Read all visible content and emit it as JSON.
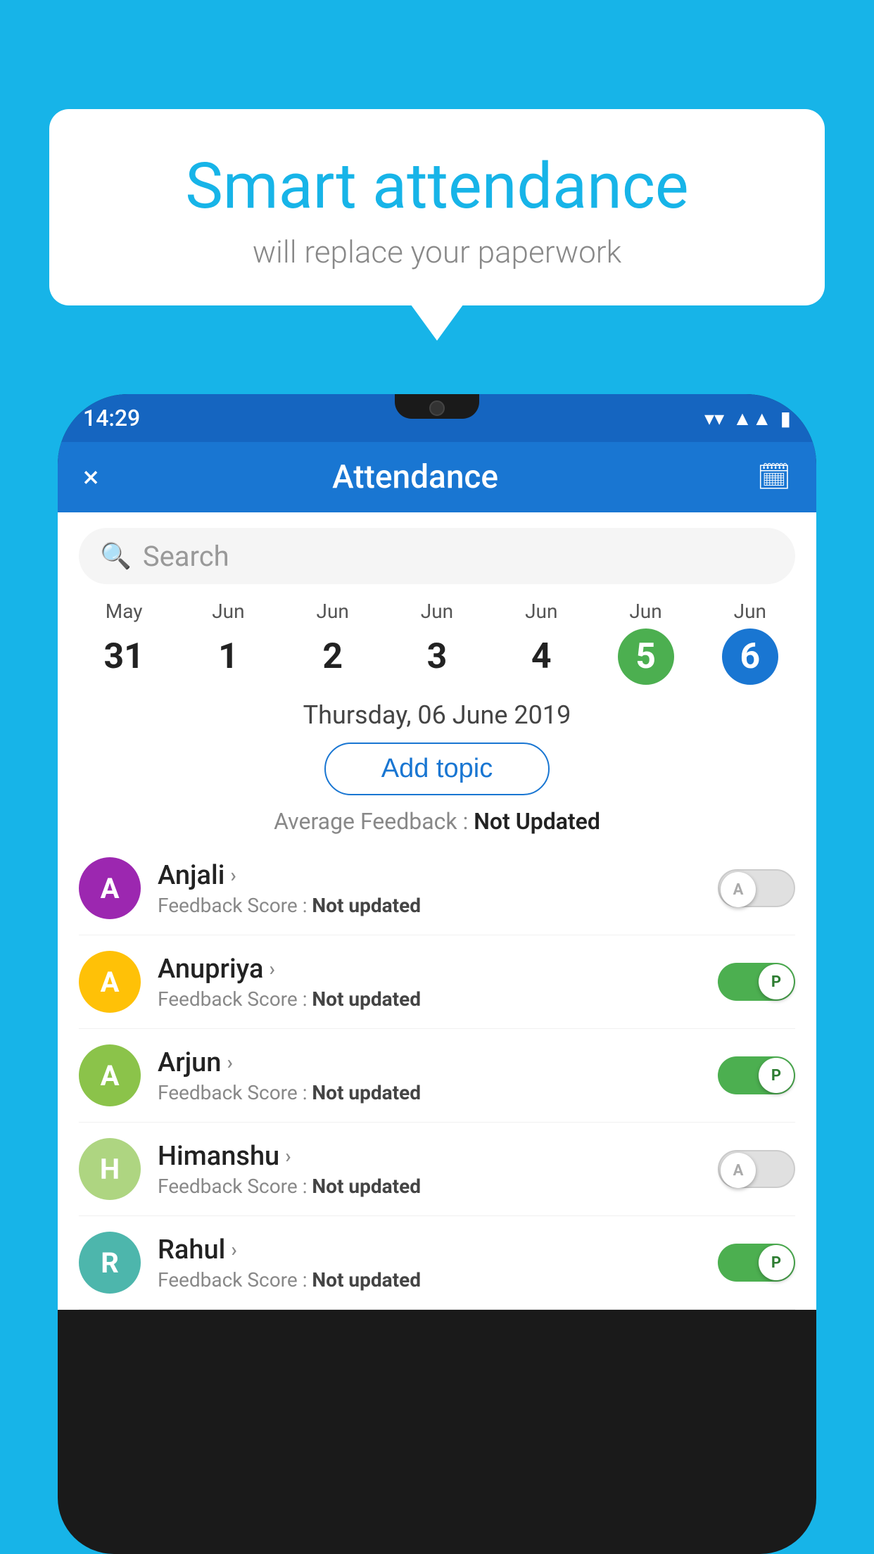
{
  "background_color": "#17b4e8",
  "bubble": {
    "title": "Smart attendance",
    "subtitle": "will replace your paperwork"
  },
  "status_bar": {
    "time": "14:29",
    "wifi_icon": "wifi",
    "signal_icon": "signal",
    "battery_icon": "battery"
  },
  "app_bar": {
    "close_label": "×",
    "title": "Attendance",
    "calendar_icon": "📅"
  },
  "search": {
    "placeholder": "Search"
  },
  "calendar": {
    "days": [
      {
        "month": "May",
        "date": "31",
        "state": "normal"
      },
      {
        "month": "Jun",
        "date": "1",
        "state": "normal"
      },
      {
        "month": "Jun",
        "date": "2",
        "state": "normal"
      },
      {
        "month": "Jun",
        "date": "3",
        "state": "normal"
      },
      {
        "month": "Jun",
        "date": "4",
        "state": "normal"
      },
      {
        "month": "Jun",
        "date": "5",
        "state": "today"
      },
      {
        "month": "Jun",
        "date": "6",
        "state": "selected"
      }
    ],
    "selected_label": "Thursday, 06 June 2019"
  },
  "add_topic_button": "Add topic",
  "average_feedback": {
    "label": "Average Feedback :",
    "value": "Not Updated"
  },
  "students": [
    {
      "name": "Anjali",
      "avatar_letter": "A",
      "avatar_color": "#9c27b0",
      "feedback": "Feedback Score : Not updated",
      "toggle": "off",
      "toggle_letter": "A"
    },
    {
      "name": "Anupriya",
      "avatar_letter": "A",
      "avatar_color": "#ffc107",
      "feedback": "Feedback Score : Not updated",
      "toggle": "on",
      "toggle_letter": "P"
    },
    {
      "name": "Arjun",
      "avatar_letter": "A",
      "avatar_color": "#8bc34a",
      "feedback": "Feedback Score : Not updated",
      "toggle": "on",
      "toggle_letter": "P"
    },
    {
      "name": "Himanshu",
      "avatar_letter": "H",
      "avatar_color": "#aed581",
      "feedback": "Feedback Score : Not updated",
      "toggle": "off",
      "toggle_letter": "A"
    },
    {
      "name": "Rahul",
      "avatar_letter": "R",
      "avatar_color": "#4db6ac",
      "feedback": "Feedback Score : Not updated",
      "toggle": "on",
      "toggle_letter": "P"
    }
  ]
}
